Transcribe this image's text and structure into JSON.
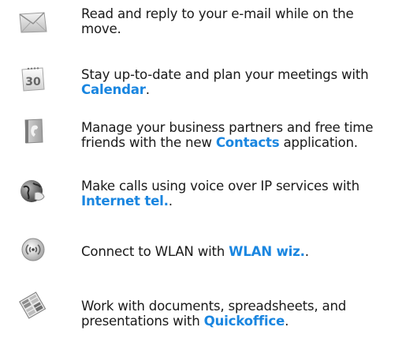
{
  "features": [
    {
      "icon": "envelope-icon",
      "text_before": "Read and reply to your e-mail while on the move.",
      "link": "",
      "text_after": ""
    },
    {
      "icon": "calendar-icon",
      "icon_day": "30",
      "text_before": "Stay up-to-date and plan your meetings with ",
      "link": "Calendar",
      "text_after": "."
    },
    {
      "icon": "contacts-book-icon",
      "text_before": "Manage your business partners and free time friends with the new ",
      "link": "Contacts",
      "text_after": " application."
    },
    {
      "icon": "globe-phone-icon",
      "text_before": "Make calls using voice over IP services with ",
      "link": "Internet tel.",
      "text_after": "."
    },
    {
      "icon": "wlan-antenna-icon",
      "text_before": "Connect to WLAN with ",
      "link": "WLAN wiz.",
      "text_after": "."
    },
    {
      "icon": "quickoffice-icon",
      "text_before": "Work with documents, spreadsheets, and presentations with ",
      "link": "Quickoffice",
      "text_after": "."
    }
  ],
  "colors": {
    "link": "#1a86e0",
    "text": "#1a1a1a"
  }
}
